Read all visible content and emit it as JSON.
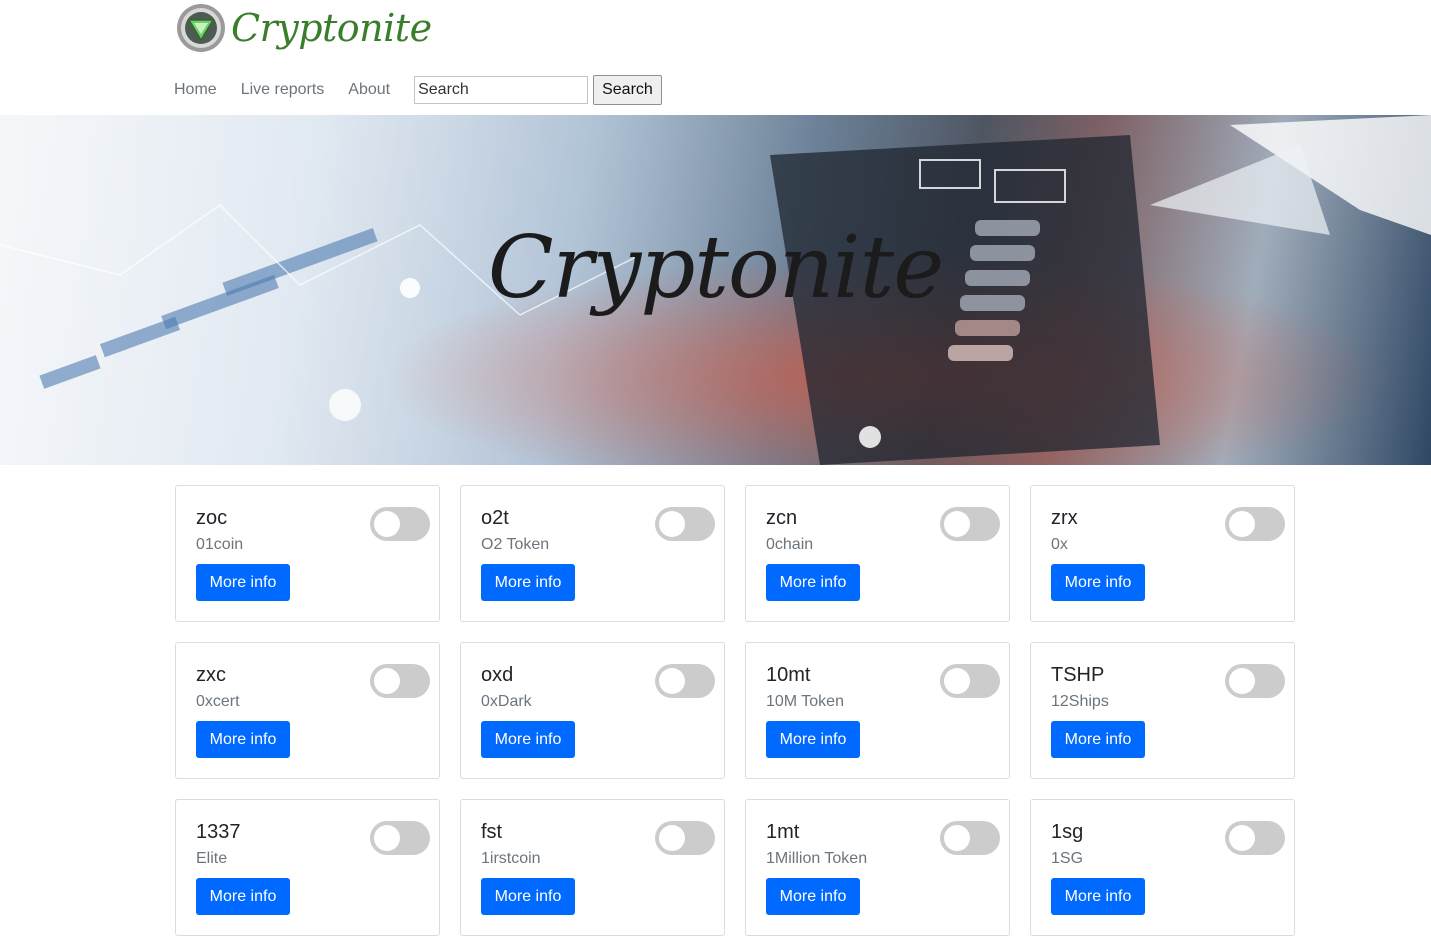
{
  "header": {
    "logo_text": "Cryptonite",
    "nav": [
      "Home",
      "Live reports",
      "About"
    ],
    "search": {
      "placeholder": "Search",
      "button_label": "Search"
    }
  },
  "hero": {
    "title": "Cryptonite"
  },
  "colors": {
    "accent": "#0069ff",
    "logo_green": "#3a7d2a",
    "toggle_off": "#cccccc"
  },
  "coins": [
    {
      "symbol": "zoc",
      "name": "01coin",
      "button": "More info",
      "toggled": false
    },
    {
      "symbol": "o2t",
      "name": "O2 Token",
      "button": "More info",
      "toggled": false
    },
    {
      "symbol": "zcn",
      "name": "0chain",
      "button": "More info",
      "toggled": false
    },
    {
      "symbol": "zrx",
      "name": "0x",
      "button": "More info",
      "toggled": false
    },
    {
      "symbol": "zxc",
      "name": "0xcert",
      "button": "More info",
      "toggled": false
    },
    {
      "symbol": "oxd",
      "name": "0xDark",
      "button": "More info",
      "toggled": false
    },
    {
      "symbol": "10mt",
      "name": "10M Token",
      "button": "More info",
      "toggled": false
    },
    {
      "symbol": "TSHP",
      "name": "12Ships",
      "button": "More info",
      "toggled": false
    },
    {
      "symbol": "1337",
      "name": "Elite",
      "button": "More info",
      "toggled": false
    },
    {
      "symbol": "fst",
      "name": "1irstcoin",
      "button": "More info",
      "toggled": false
    },
    {
      "symbol": "1mt",
      "name": "1Million Token",
      "button": "More info",
      "toggled": false
    },
    {
      "symbol": "1sg",
      "name": "1SG",
      "button": "More info",
      "toggled": false
    }
  ]
}
